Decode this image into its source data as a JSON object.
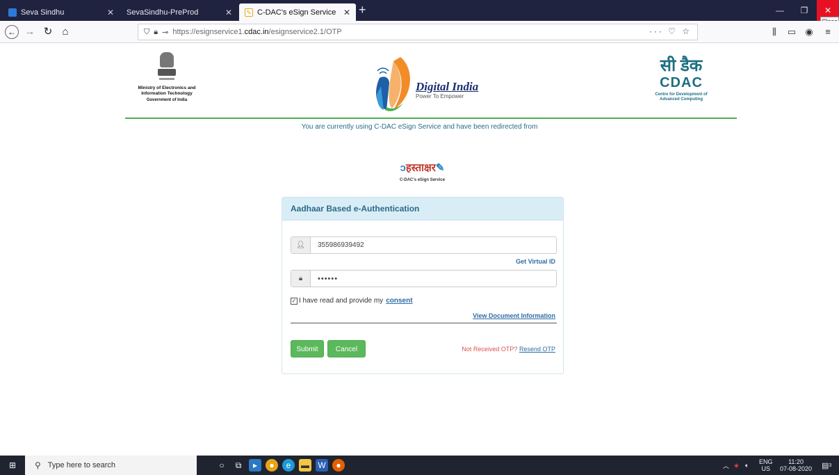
{
  "browser": {
    "tabs": [
      {
        "title": "Seva Sindhu",
        "favicon_color": "#2b7bd6"
      },
      {
        "title": "SevaSindhu-PreProd",
        "favicon_color": ""
      },
      {
        "title": "C-DAC's eSign Service",
        "favicon_color": "#e8a317"
      }
    ],
    "active_tab": 2,
    "close_tooltip": "Close",
    "url_prefix": "https://esignservice1.",
    "url_domain": "cdac.in",
    "url_path": "/esignservice2.1/OTP",
    "url_extra": "··· ♡ ☆"
  },
  "header": {
    "ministry_line1": "Ministry of Electronics and",
    "ministry_line2": "Information Technology",
    "ministry_line3": "Government of India",
    "digital_india": "Digital India",
    "digital_india_tagline": "Power To Empower",
    "cdac_hindi": "सी डैक",
    "cdac_brand": "CDAC",
    "cdac_sub1": "Centre for Development of",
    "cdac_sub2": "Advanced Computing",
    "redirect_text": "You are currently using C-DAC eSign Service and have been redirected from"
  },
  "hastakshar": {
    "title": "हस्ताक्षर",
    "subtitle": "C-DAC's eSign Service"
  },
  "panel": {
    "title": "Aadhaar Based e-Authentication",
    "aadhaar_value": "355986939492",
    "get_virtual_id": "Get Virtual ID",
    "otp_value": "••••••",
    "consent_text": "I have read and provide my",
    "consent_link": "consent",
    "view_doc": "View Document Information",
    "submit": "Submit",
    "cancel": "Cancel",
    "not_received": "Not Received OTP?",
    "resend": "Resend OTP"
  },
  "taskbar": {
    "search_placeholder": "Type here to search",
    "lang": "ENG",
    "region": "US",
    "time": "11:20",
    "date": "07-08-2020",
    "notifications": "3"
  },
  "colors": {
    "tabstrip": "#202340",
    "accent_green": "#5cb85c",
    "panel_head": "#d9edf7",
    "link_blue": "#2e6da4",
    "error_red": "#d9534f"
  }
}
